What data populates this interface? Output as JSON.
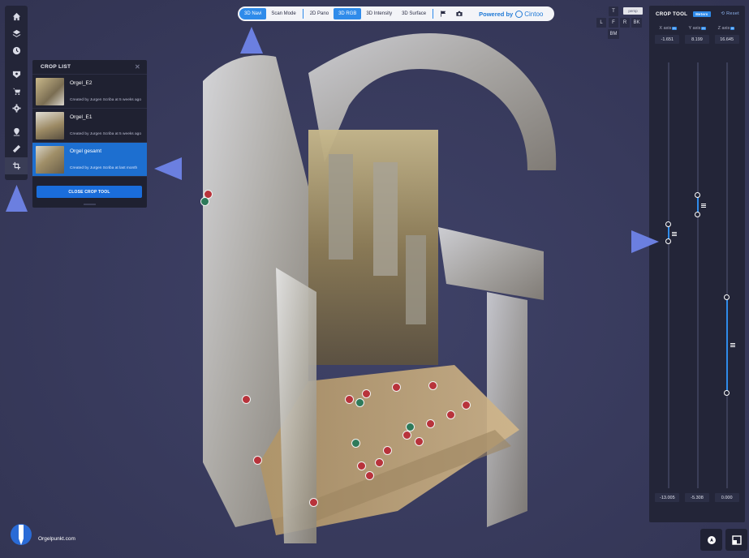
{
  "crop_list": {
    "title": "CROP LIST",
    "items": [
      {
        "name": "Orgel_E2",
        "meta": "Created by Jurgen Scriba at 5 weeks ago",
        "selected": false
      },
      {
        "name": "Orgel_E1",
        "meta": "Created by Jurgen Scriba at 5 weeks ago",
        "selected": false
      },
      {
        "name": "Orgel gesamt",
        "meta": "Created by Jurgen Scriba at last month",
        "selected": true
      }
    ],
    "close_button": "CLOSE CROP TOOL"
  },
  "top_bar": {
    "nav_buttons": [
      "3D Navi",
      "Scan Mode"
    ],
    "view_buttons": [
      "2D Pano",
      "3D RGB",
      "3D Intensity",
      "3D Surface"
    ],
    "active": [
      "3D Navi",
      "3D RGB"
    ],
    "powered_by": "Powered by",
    "brand": "Cintoo"
  },
  "view_cube": {
    "top": "T",
    "left": "L",
    "front": "F",
    "right": "R",
    "back": "BK",
    "bottom": "BM",
    "perspective": "persp"
  },
  "crop_tool": {
    "title": "CROP TOOL",
    "unit": "Meters",
    "reset": "Reset",
    "axes": [
      {
        "label": "X axis",
        "tag": "m",
        "top": "-1.651",
        "bottom": "-13.005"
      },
      {
        "label": "Y axis",
        "tag": "m",
        "top": "8.199",
        "bottom": "-5.308"
      },
      {
        "label": "Z axis",
        "tag": "m",
        "top": "16.645",
        "bottom": "0.000"
      }
    ]
  },
  "footer": {
    "site": "Orgelpunkt.com"
  },
  "colors": {
    "accent": "#2f8bea",
    "panel": "#232538",
    "background": "#383a5e",
    "tutorial_arrow": "#6b7fe0"
  }
}
